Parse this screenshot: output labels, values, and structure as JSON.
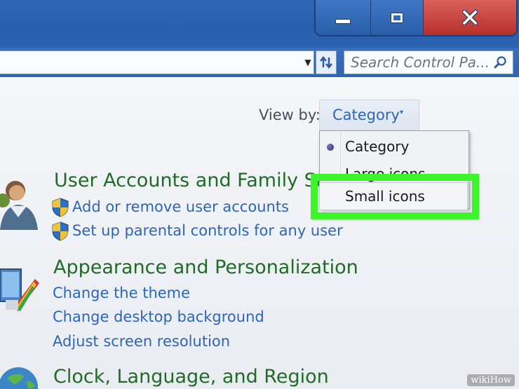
{
  "window": {
    "minimize_icon": "minimize-icon",
    "maximize_icon": "maximize-icon",
    "close_icon": "close-icon",
    "close_color": "#c13a31"
  },
  "toolbar": {
    "address_value": "",
    "refresh_icon": "back-forward-refresh-icon",
    "search_placeholder": "Search Control Pa...",
    "search_icon": "magnifier-icon"
  },
  "view_by": {
    "label": "View by:",
    "selected": "Category",
    "caret": "▾"
  },
  "view_menu": {
    "items": [
      {
        "label": "Category",
        "selected": true
      },
      {
        "label": "Large icons",
        "selected": false
      },
      {
        "label": "Small icons",
        "selected": false,
        "highlighted": true
      }
    ],
    "highlight_color": "#3df52b"
  },
  "categories": [
    {
      "title": "User Accounts and Family Sa",
      "icon": "users-icon",
      "links": [
        {
          "label": "Add or remove user accounts",
          "shield": true
        },
        {
          "label": "Set up parental controls for any user",
          "shield": true
        }
      ]
    },
    {
      "title": "Appearance and Personalization",
      "icon": "appearance-icon",
      "links": [
        {
          "label": "Change the theme",
          "shield": false
        },
        {
          "label": "Change desktop background",
          "shield": false
        },
        {
          "label": "Adjust screen resolution",
          "shield": false
        }
      ]
    },
    {
      "title": "Clock, Language, and Region",
      "icon": "globe-icon",
      "links": []
    }
  ],
  "watermark": "wikiHow"
}
